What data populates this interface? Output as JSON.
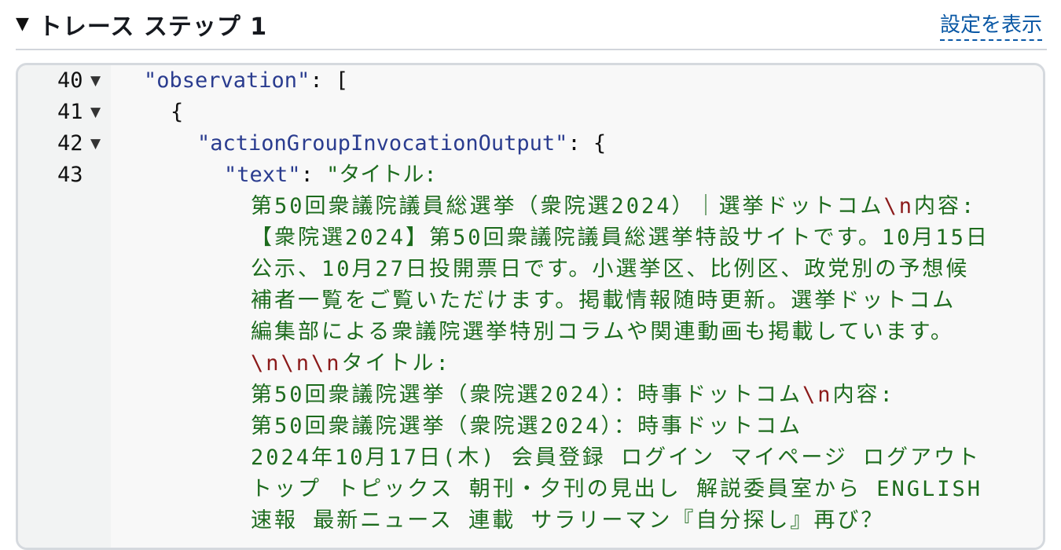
{
  "header": {
    "title": "トレース ステップ 1",
    "settings_link": "設定を表示"
  },
  "code": {
    "lines": [
      {
        "number": "40"
      },
      {
        "number": "41"
      },
      {
        "number": "42"
      },
      {
        "number": "43"
      }
    ],
    "l40": {
      "key": "\"observation\"",
      "rest": ": ["
    },
    "l41": {
      "text": "{"
    },
    "l42": {
      "key": "\"actionGroupInvocationOutput\"",
      "rest": ": {"
    },
    "l43": {
      "key": "\"text\"",
      "colon": ": ",
      "str": "\"タイトル:"
    },
    "w1": {
      "a": "第50回衆議院議員総選挙（衆院選2024）｜選挙ドットコム",
      "esc": "\\n",
      "b": "内容:"
    },
    "w2": "【衆院選2024】第50回衆議院議員総選挙特設サイトです。10月15日",
    "w3": "公示、10月27日投開票日です。小選挙区、比例区、政党別の予想候",
    "w4": "補者一覧をご覧いただけます。掲載情報随時更新。選挙ドットコム",
    "w5": "編集部による衆議院選挙特別コラムや関連動画も掲載しています。",
    "w6": {
      "esc": "\\n\\n\\n",
      "b": "タイトル:"
    },
    "w7": {
      "a": "第50回衆議院選挙（衆院選2024）：時事ドットコム",
      "esc": "\\n",
      "b": "内容:"
    },
    "w8": "第50回衆議院選挙（衆院選2024）：時事ドットコム",
    "w9": "2024年10月17日(木) 会員登録 ログイン マイページ ログアウト",
    "w10": "トップ トピックス 朝刊・夕刊の見出し 解説委員室から ENGLISH",
    "w11": "速報 最新ニュース 連載 サラリーマン『自分探し』再び？"
  }
}
